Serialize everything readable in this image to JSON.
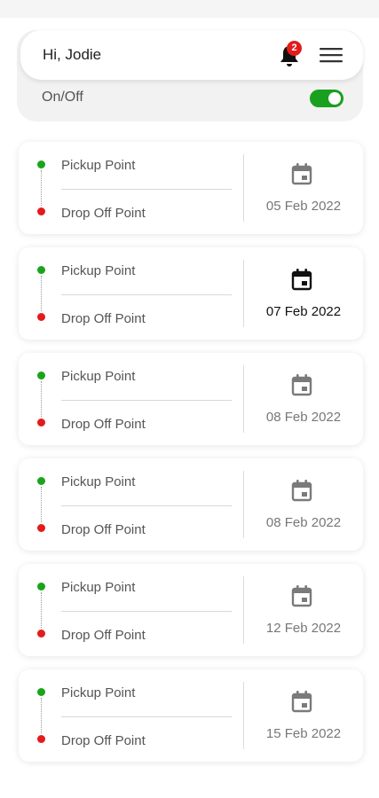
{
  "header": {
    "greeting": "Hi, Jodie",
    "notification_count": "2",
    "onoff_label": "On/Off",
    "toggle_on": true,
    "accent_color": "#19a01f"
  },
  "trips": [
    {
      "pickup": "Pickup Point",
      "dropoff": "Drop Off Point",
      "date": "05 Feb 2022",
      "active": false
    },
    {
      "pickup": "Pickup Point",
      "dropoff": "Drop Off Point",
      "date": "07 Feb 2022",
      "active": true
    },
    {
      "pickup": "Pickup Point",
      "dropoff": "Drop Off Point",
      "date": "08 Feb 2022",
      "active": false
    },
    {
      "pickup": "Pickup Point",
      "dropoff": "Drop Off Point",
      "date": "08 Feb 2022",
      "active": false
    },
    {
      "pickup": "Pickup Point",
      "dropoff": "Drop Off Point",
      "date": "12 Feb 2022",
      "active": false
    },
    {
      "pickup": "Pickup Point",
      "dropoff": "Drop Off Point",
      "date": "15 Feb 2022",
      "active": false
    }
  ],
  "icons": {
    "bell": "bell-icon",
    "menu": "hamburger-menu-icon",
    "calendar": "calendar-icon"
  }
}
